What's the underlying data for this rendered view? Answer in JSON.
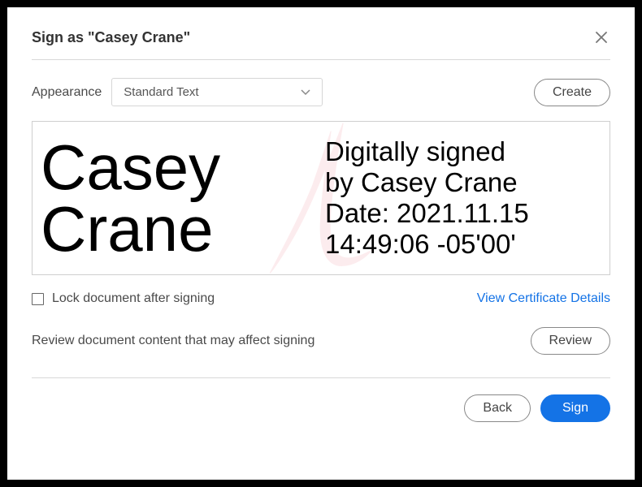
{
  "header": {
    "title": "Sign as \"Casey Crane\""
  },
  "appearance": {
    "label": "Appearance",
    "selected": "Standard Text",
    "create_label": "Create"
  },
  "preview": {
    "signer_name": "Casey\nCrane",
    "info_line1": "Digitally signed",
    "info_line2": "by Casey Crane",
    "info_line3": "Date: 2021.11.15",
    "info_line4": "14:49:06 -05'00'"
  },
  "lock": {
    "label": "Lock document after signing",
    "view_details": "View Certificate Details"
  },
  "review": {
    "text": "Review document content that may affect signing",
    "button": "Review"
  },
  "footer": {
    "back": "Back",
    "sign": "Sign"
  }
}
